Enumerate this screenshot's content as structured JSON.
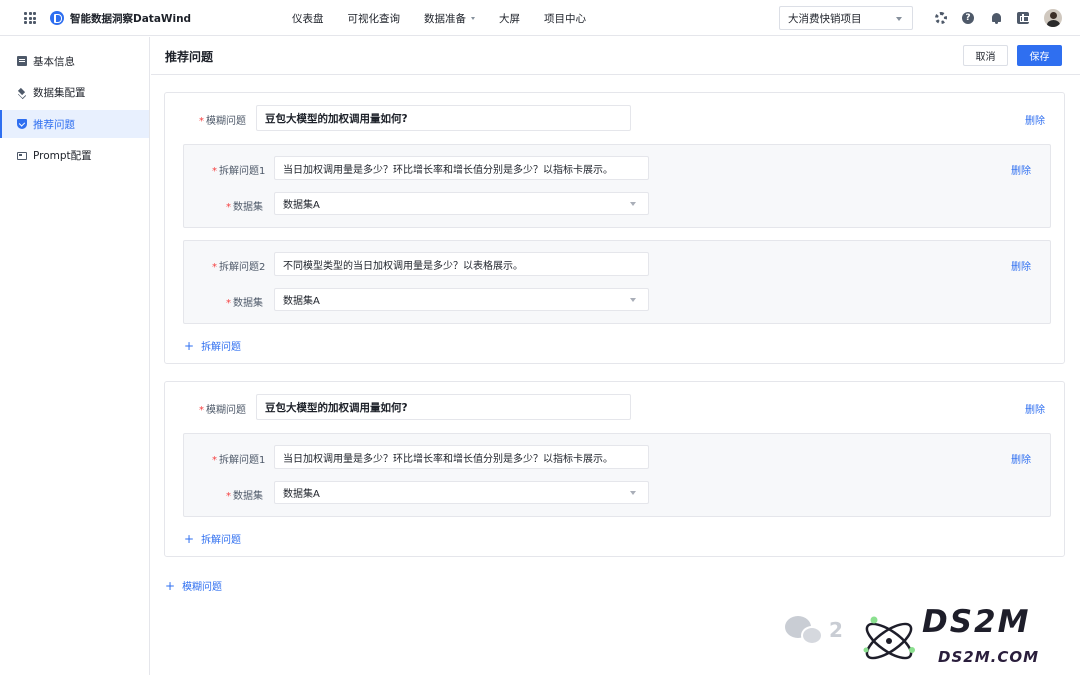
{
  "header": {
    "app_title": "智能数据洞察DataWind",
    "nav": [
      {
        "label": "仪表盘",
        "has_dropdown": false
      },
      {
        "label": "可视化查询",
        "has_dropdown": false
      },
      {
        "label": "数据准备",
        "has_dropdown": true
      },
      {
        "label": "大屏",
        "has_dropdown": false
      },
      {
        "label": "项目中心",
        "has_dropdown": false
      }
    ],
    "project": "大消费快销项目",
    "icons": [
      "grid-icon",
      "logo-icon",
      "gear-icon",
      "help-icon",
      "bell-icon",
      "language-icon",
      "avatar"
    ]
  },
  "sidebar": {
    "items": [
      {
        "label": "基本信息",
        "icon": "document-icon",
        "active": false
      },
      {
        "label": "数据集配置",
        "icon": "layers-icon",
        "active": false
      },
      {
        "label": "推荐问题",
        "icon": "shield-icon",
        "active": true
      },
      {
        "label": "Prompt配置",
        "icon": "monitor-icon",
        "active": false
      }
    ]
  },
  "page": {
    "title": "推荐问题",
    "cancel_label": "取消",
    "save_label": "保存"
  },
  "form": {
    "fuzzy_label": "模糊问题",
    "sub_label_prefix": "拆解问题",
    "dataset_label": "数据集",
    "delete_label": "删除",
    "add_sub_label": "拆解问题",
    "add_fuzzy_label": "模糊问题",
    "groups": [
      {
        "fuzzy_question": "豆包大模型的加权调用量如何?",
        "sub_questions": [
          {
            "label": "拆解问题1",
            "question": "当日加权调用量是多少？环比增长率和增长值分别是多少？以指标卡展示。",
            "dataset": "数据集A"
          },
          {
            "label": "拆解问题2",
            "question": "不同模型类型的当日加权调用量是多少？以表格展示。",
            "dataset": "数据集A"
          }
        ]
      },
      {
        "fuzzy_question": "豆包大模型的加权调用量如何?",
        "sub_questions": [
          {
            "label": "拆解问题1",
            "question": "当日加权调用量是多少？环比增长率和增长值分别是多少？以指标卡展示。",
            "dataset": "数据集A"
          }
        ]
      }
    ]
  },
  "watermark": {
    "brand": "DS2M",
    "domain": "DS2M.COM",
    "fragment": "2"
  }
}
